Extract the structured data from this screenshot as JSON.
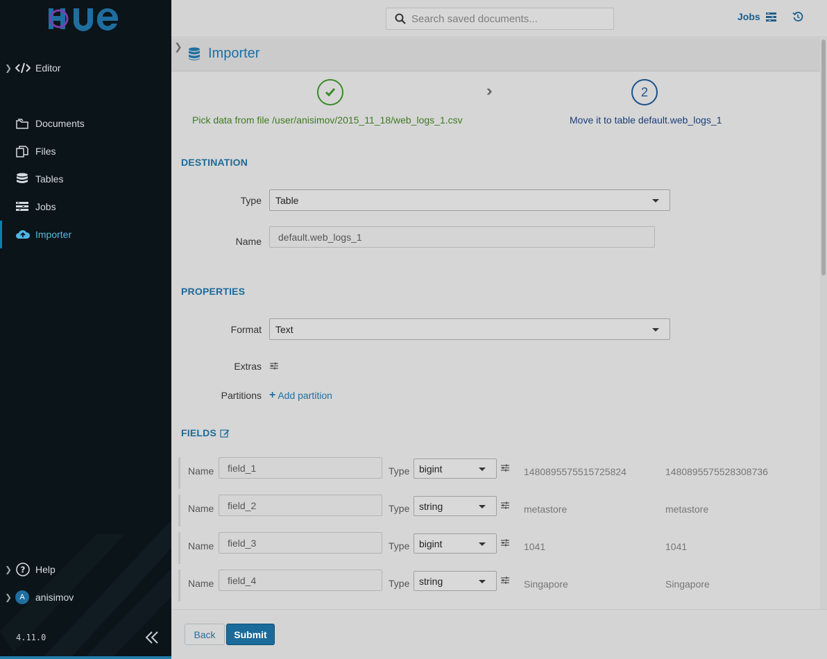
{
  "app": {
    "logo_text": "HUE",
    "version": "4.11.0"
  },
  "sidebar": {
    "items": [
      {
        "label": "Editor",
        "icon": "code-icon"
      },
      {
        "label": "Documents",
        "icon": "folder-icon"
      },
      {
        "label": "Files",
        "icon": "files-icon"
      },
      {
        "label": "Tables",
        "icon": "database-icon"
      },
      {
        "label": "Jobs",
        "icon": "jobs-icon"
      },
      {
        "label": "Importer",
        "icon": "cloud-upload-icon",
        "active": true
      }
    ],
    "help_label": "Help",
    "user_label": "anisimov",
    "user_initial": "A"
  },
  "topbar": {
    "search_placeholder": "Search saved documents...",
    "jobs_label": "Jobs"
  },
  "page": {
    "title": "Importer"
  },
  "steps": {
    "step1_label": "Pick data from file /user/anisimov/2015_11_18/web_logs_1.csv",
    "step2_number": "2",
    "step2_label": "Move it to table default.web_logs_1"
  },
  "destination": {
    "section_title": "DESTINATION",
    "type_label": "Type",
    "type_value": "Table",
    "name_label": "Name",
    "name_value": "default.web_logs_1"
  },
  "properties": {
    "section_title": "PROPERTIES",
    "format_label": "Format",
    "format_value": "Text",
    "extras_label": "Extras",
    "partitions_label": "Partitions",
    "add_partition_label": "Add partition"
  },
  "fields": {
    "section_title": "FIELDS",
    "name_label": "Name",
    "type_label": "Type",
    "rows": [
      {
        "name": "field_1",
        "type": "bigint",
        "sample1": "1480895575515725824",
        "sample2": "1480895575528308736"
      },
      {
        "name": "field_2",
        "type": "string",
        "sample1": "metastore",
        "sample2": "metastore"
      },
      {
        "name": "field_3",
        "type": "bigint",
        "sample1": "1041",
        "sample2": "1041"
      },
      {
        "name": "field_4",
        "type": "string",
        "sample1": "Singapore",
        "sample2": "Singapore"
      }
    ]
  },
  "actions": {
    "back_label": "Back",
    "submit_label": "Submit"
  },
  "colors": {
    "accent": "#1a6b9a",
    "sidebar_bg": "#0b1419",
    "success": "#3b8a2a"
  }
}
